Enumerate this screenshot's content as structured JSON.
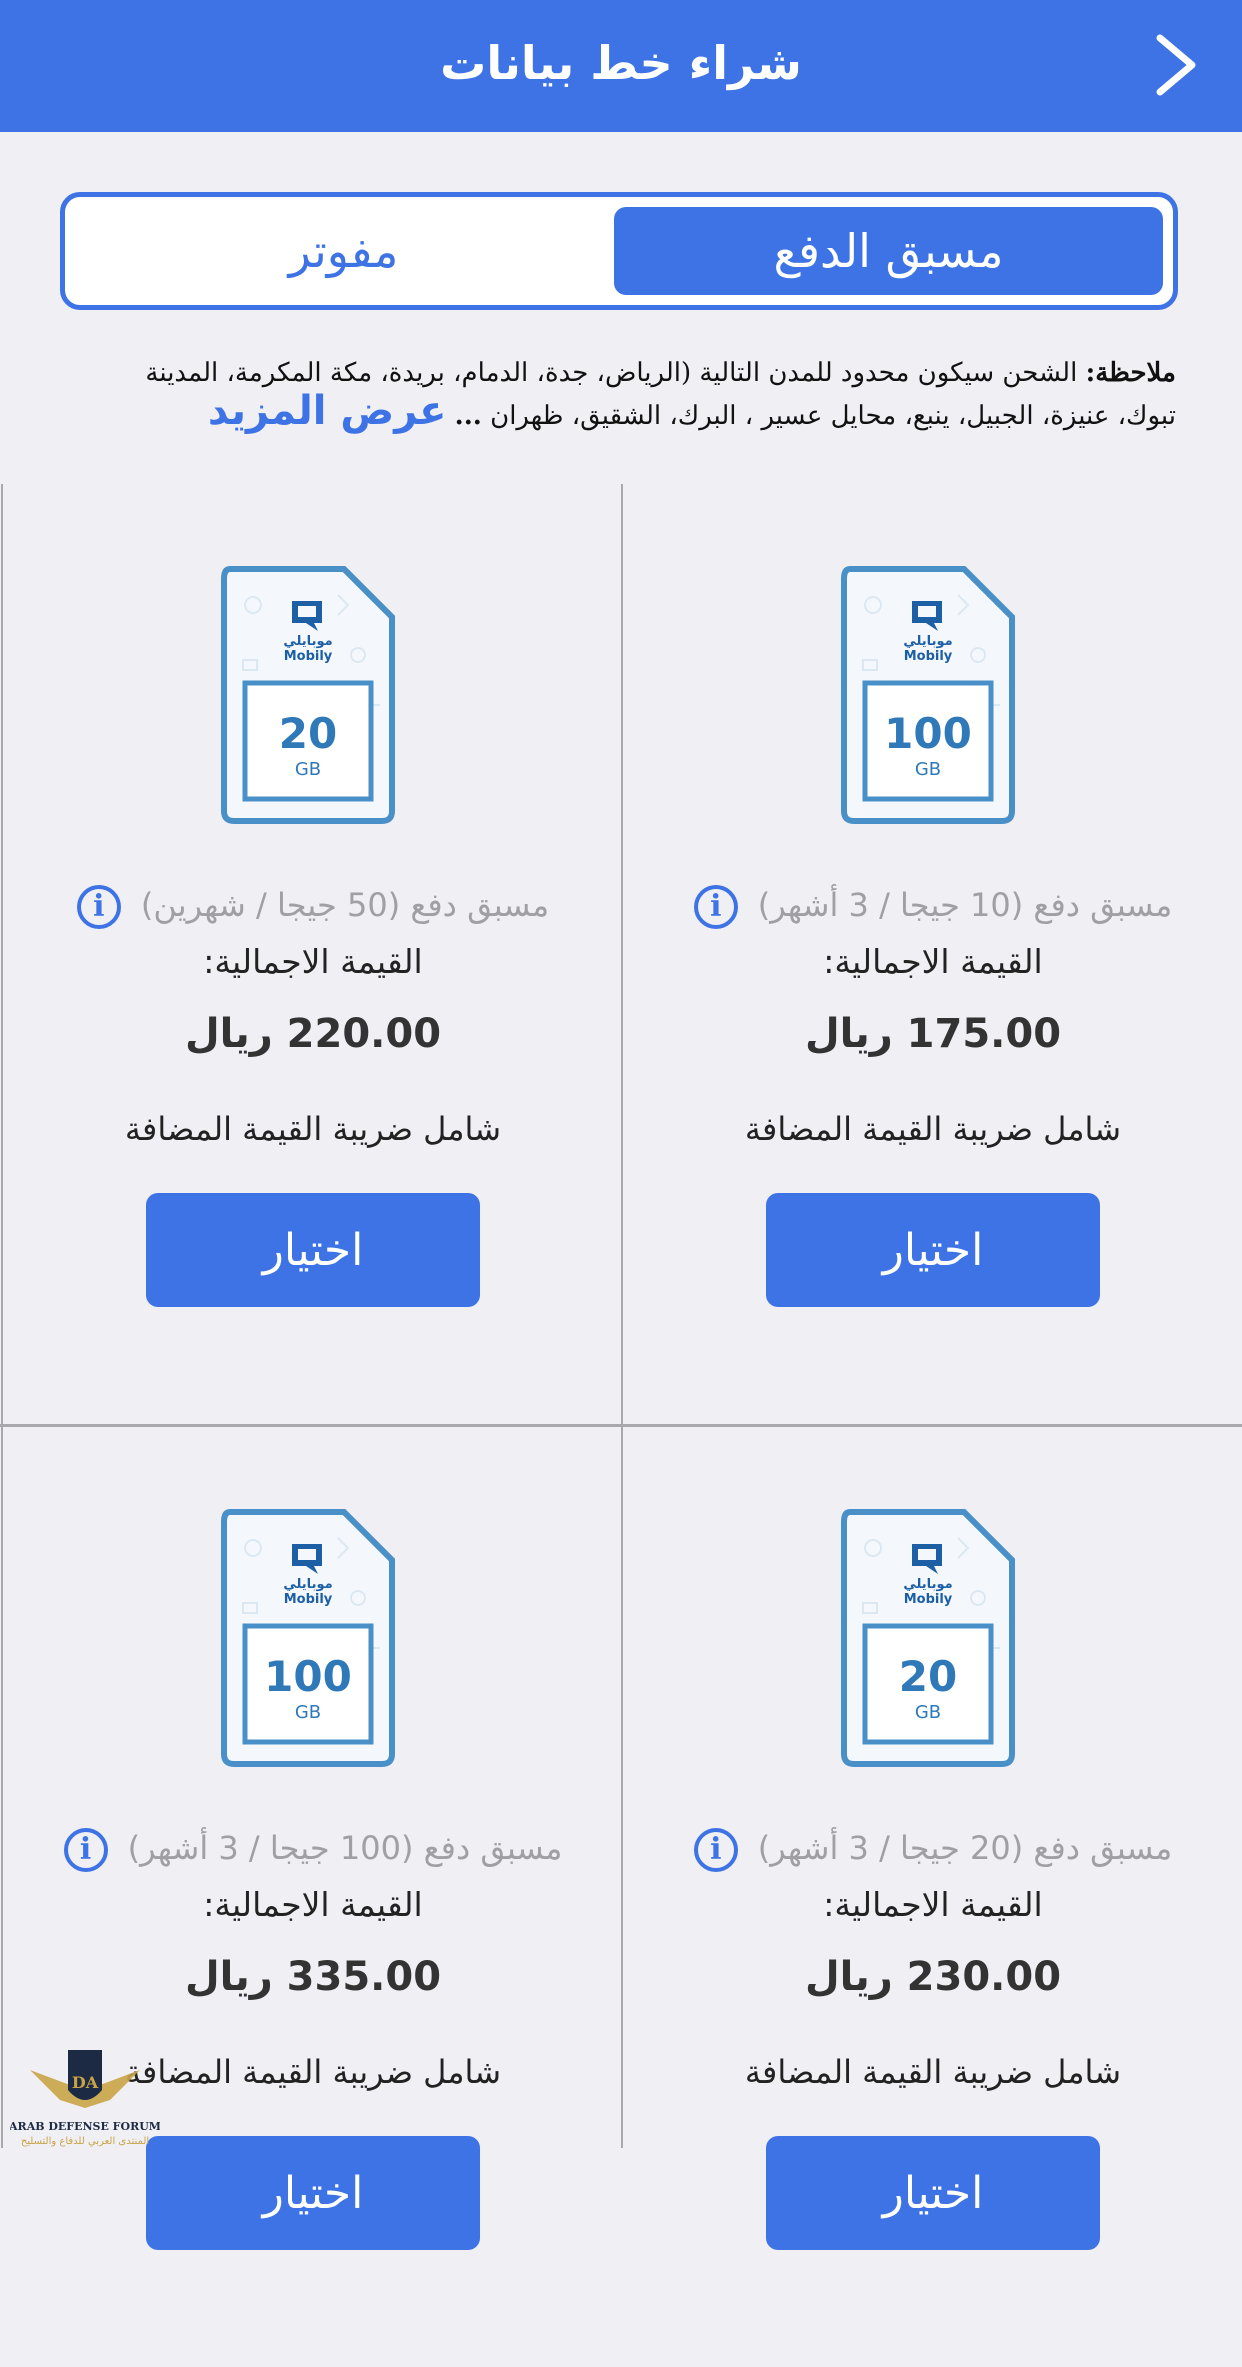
{
  "header": {
    "title": "شراء خط بيانات"
  },
  "tabs": {
    "prepaid": "مسبق الدفع",
    "postpaid": "مفوتر"
  },
  "note": {
    "label": "ملاحظة:",
    "text": "الشحن سيكون محدود للمدن التالية (الرياض، جدة، الدمام، بريدة، مكة المكرمة، المدينة تبوك، عنيزة، الجبيل، ينبع،  محايل عسير ، البرك، الشقيق، ظهران",
    "ellipsis": "...",
    "more": "عرض المزيد"
  },
  "colors": {
    "accent": "#3d73e4",
    "background": "#efeff4",
    "sim": "#4a90c8"
  },
  "plans": [
    {
      "name": "مسبق دفع (10 جيجا / 3 أشهر)",
      "label": "القيمة الاجمالية:",
      "price": "175.00 ريال",
      "vat": "شامل ضريبة القيمة المضافة",
      "button": "اختيار",
      "sim_size": "100",
      "sim_unit": "GB",
      "sim_brand_ar": "موبايلي",
      "sim_brand_en": "Mobily"
    },
    {
      "name": "مسبق دفع (50 جيجا / شهرين)",
      "label": "القيمة الاجمالية:",
      "price": "220.00 ريال",
      "vat": "شامل ضريبة القيمة المضافة",
      "button": "اختيار",
      "sim_size": "20",
      "sim_unit": "GB",
      "sim_brand_ar": "موبايلي",
      "sim_brand_en": "Mobily"
    },
    {
      "name": "مسبق دفع (20 جيجا / 3 أشهر)",
      "label": "القيمة الاجمالية:",
      "price": "230.00 ريال",
      "vat": "شامل ضريبة القيمة المضافة",
      "button": "اختيار",
      "sim_size": "20",
      "sim_unit": "GB",
      "sim_brand_ar": "موبايلي",
      "sim_brand_en": "Mobily"
    },
    {
      "name": "مسبق دفع (100 جيجا / 3 أشهر)",
      "label": "القيمة الاجمالية:",
      "price": "335.00 ريال",
      "vat": "شامل ضريبة القيمة المضافة",
      "button": "اختيار",
      "sim_size": "100",
      "sim_unit": "GB",
      "sim_brand_ar": "موبايلي",
      "sim_brand_en": "Mobily"
    }
  ],
  "watermark": {
    "text": "ARAB DEFENSE FORUM",
    "text_ar": "المنتدى العربي للدفاع والتسليح"
  }
}
